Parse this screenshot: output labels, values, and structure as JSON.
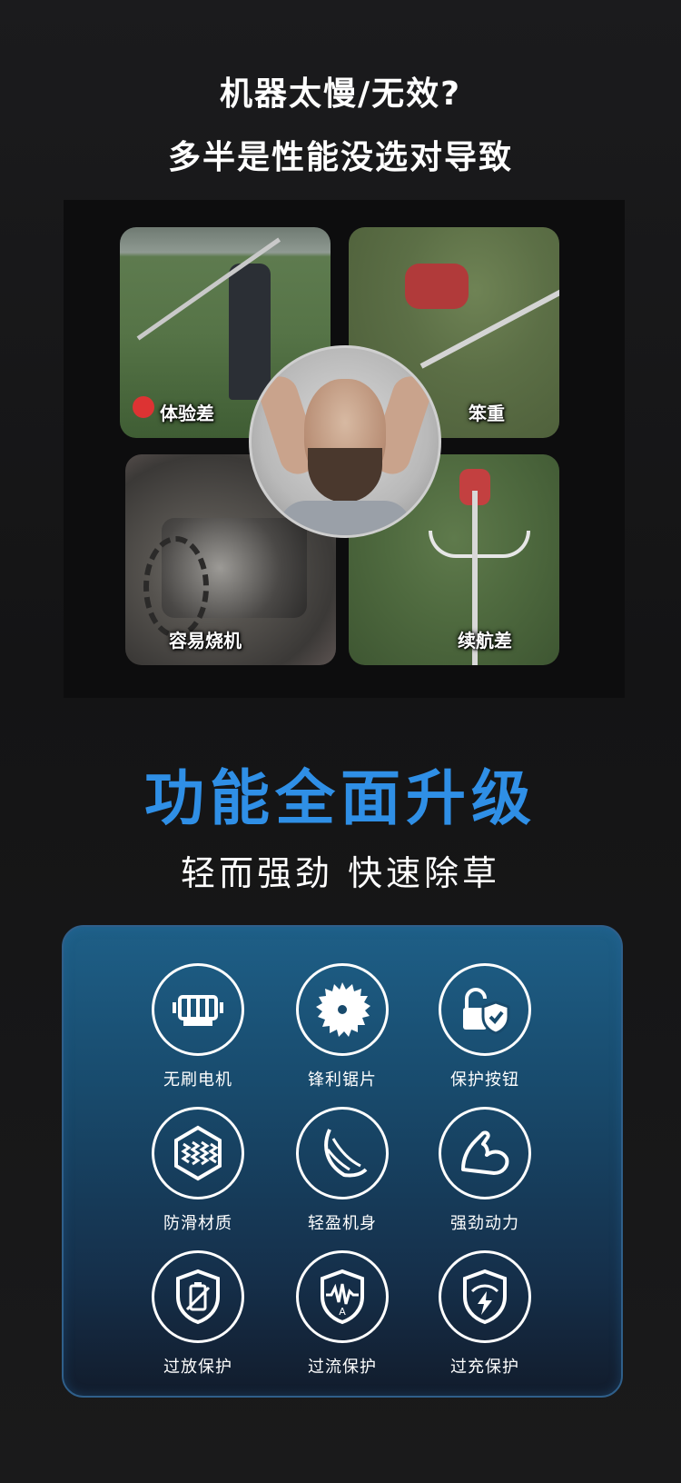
{
  "header": {
    "line1": "机器太慢/无效?",
    "line2": "多半是性能没选对导致"
  },
  "problems": [
    {
      "label": "体验差",
      "icon": "trimmer-user-photo"
    },
    {
      "label": "笨重",
      "icon": "heavy-trimmer-photo"
    },
    {
      "label": "容易烧机",
      "icon": "burnt-engine-photo"
    },
    {
      "label": "续航差",
      "icon": "trimmer-handle-photo"
    }
  ],
  "upgrade": {
    "title": "功能全面升级",
    "subtitle": "轻而强劲  快速除草",
    "title_color": "#2f8fe6"
  },
  "features": [
    {
      "label": "无刷电机",
      "icon": "motor-icon"
    },
    {
      "label": "锋利锯片",
      "icon": "saw-blade-icon"
    },
    {
      "label": "保护按钮",
      "icon": "lock-shield-icon"
    },
    {
      "label": "防滑材质",
      "icon": "hexagon-texture-icon"
    },
    {
      "label": "轻盈机身",
      "icon": "feather-icon"
    },
    {
      "label": "强劲动力",
      "icon": "flexed-arm-icon"
    },
    {
      "label": "过放保护",
      "icon": "battery-shield-icon"
    },
    {
      "label": "过流保护",
      "icon": "current-shield-icon"
    },
    {
      "label": "过充保护",
      "icon": "lightning-shield-icon"
    }
  ]
}
